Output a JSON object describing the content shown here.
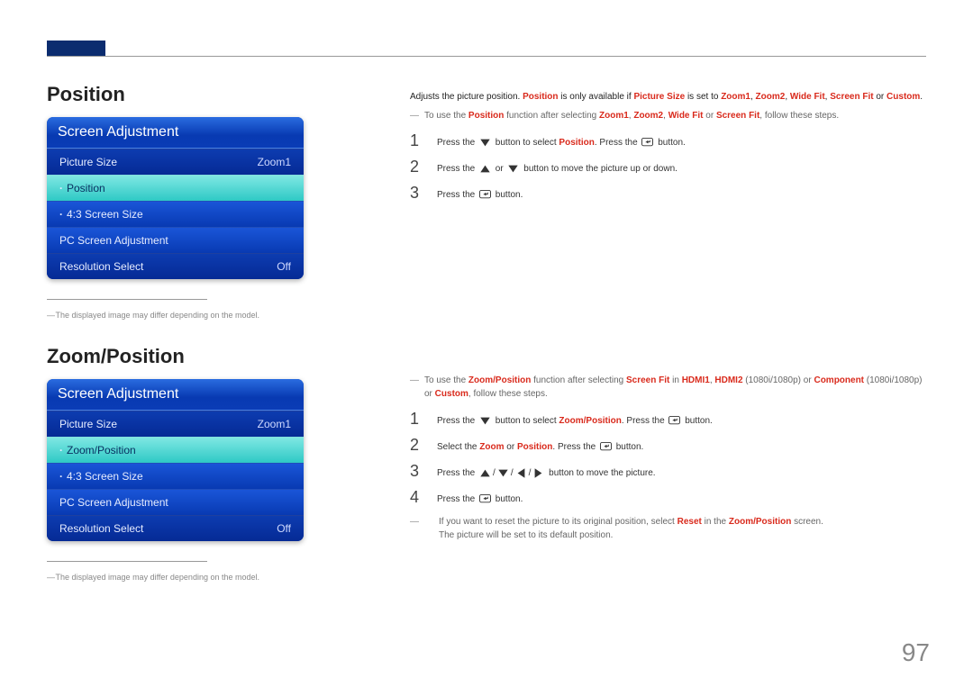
{
  "page_number": "97",
  "position": {
    "title": "Position",
    "osd_title": "Screen Adjustment",
    "rows": {
      "picture_size_label": "Picture Size",
      "picture_size_value": "Zoom1",
      "selected": "Position",
      "size_43": "4:3 Screen Size",
      "pc_adj": "PC Screen Adjustment",
      "res_sel_label": "Resolution Select",
      "res_sel_value": "Off"
    },
    "disclaimer": "The displayed image may differ depending on the model.",
    "intro": {
      "pre1": "Adjusts the picture position. ",
      "bold1": "Position",
      "mid1": " is only available if ",
      "bold2": "Picture Size",
      "mid2": " is set to ",
      "v1": "Zoom1",
      "c": ", ",
      "v2": "Zoom2",
      "v3": "Wide Fit",
      "v4": "Screen Fit",
      "or": " or ",
      "v5": "Custom",
      "dot": "."
    },
    "note": {
      "pre": "To use the ",
      "bold": "Position",
      "mid": " function after selecting ",
      "v1": "Zoom1",
      "c": ", ",
      "v2": "Zoom2",
      "v3": "Wide Fit",
      "or": " or ",
      "v4": "Screen Fit",
      "post": ", follow these steps."
    },
    "steps": {
      "s1a": "Press the ",
      "s1b": " button to select ",
      "s1c": "Position",
      "s1d": ". Press the ",
      "s1e": " button.",
      "s2a": "Press the ",
      "s2b": " or ",
      "s2c": " button to move the picture up or down.",
      "s3a": "Press the ",
      "s3b": " button."
    }
  },
  "zoom": {
    "title": "Zoom/Position",
    "osd_title": "Screen Adjustment",
    "rows": {
      "picture_size_label": "Picture Size",
      "picture_size_value": "Zoom1",
      "selected": "Zoom/Position",
      "size_43": "4:3 Screen Size",
      "pc_adj": "PC Screen Adjustment",
      "res_sel_label": "Resolution Select",
      "res_sel_value": "Off"
    },
    "disclaimer": "The displayed image may differ depending on the model.",
    "note1": {
      "pre": "To use the ",
      "bold": "Zoom/Position",
      "mid1": " function after selecting ",
      "sf": "Screen Fit",
      "mid2": " in ",
      "h1": "HDMI1",
      "c": ", ",
      "h2": "HDMI2",
      "paren1": " (1080i/1080p) or ",
      "comp": "Component",
      "paren2": " (1080i/1080p) or ",
      "cust": "Custom",
      "post": ", follow these steps."
    },
    "steps": {
      "s1a": "Press the ",
      "s1b": " button to select ",
      "s1c": "Zoom/Position",
      "s1d": ". Press the ",
      "s1e": " button.",
      "s2a": "Select the ",
      "s2z": "Zoom",
      "s2or": " or ",
      "s2p": "Position",
      "s2d": ". Press the ",
      "s2e": " button.",
      "s3a": "Press the ",
      "s3b": " button to move the picture.",
      "s4a": "Press the ",
      "s4b": " button."
    },
    "note2": {
      "pre": "If you want to reset the picture to its original position, select ",
      "reset": "Reset",
      "mid": " in the ",
      "scr": "Zoom/Position",
      "post1": " screen.",
      "line2": "The picture will be set to its default position."
    }
  }
}
